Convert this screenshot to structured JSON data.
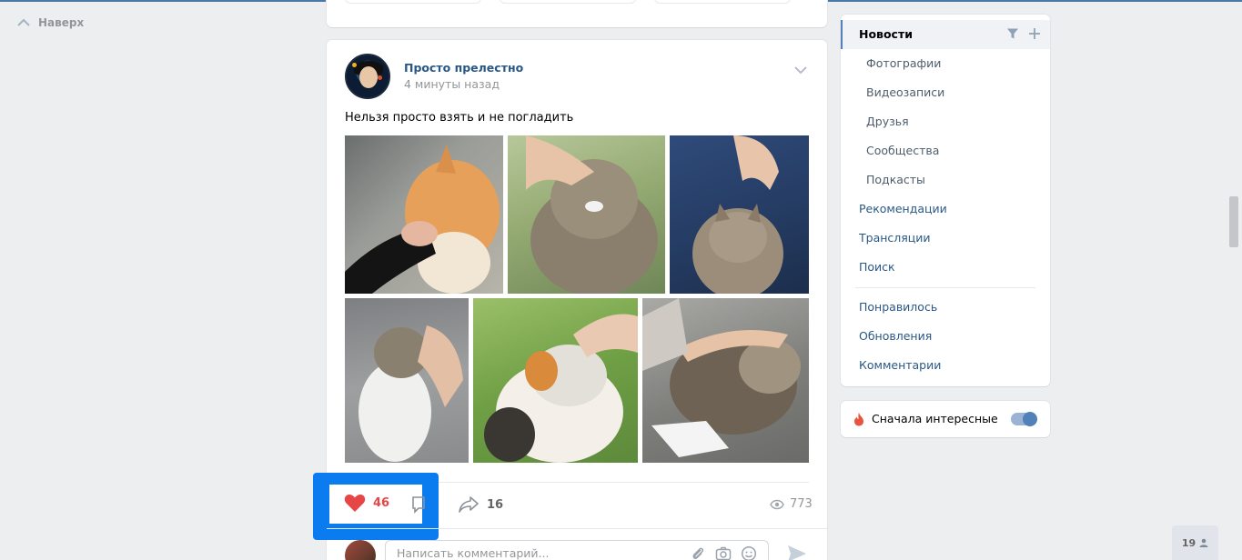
{
  "nav": {
    "back_to_top": "Наверх"
  },
  "post": {
    "author": "Просто прелестно",
    "time": "4 минуты назад",
    "text": "Нельзя просто взять и не погладить",
    "likes": "46",
    "shares": "16",
    "views": "773",
    "comment_placeholder": "Написать комментарий..."
  },
  "menu": {
    "items": [
      {
        "label": "Новости"
      },
      {
        "label": "Фотографии"
      },
      {
        "label": "Видеозаписи"
      },
      {
        "label": "Друзья"
      },
      {
        "label": "Сообщества"
      },
      {
        "label": "Подкасты"
      },
      {
        "label": "Рекомендации"
      },
      {
        "label": "Трансляции"
      },
      {
        "label": "Поиск"
      },
      {
        "label": "Понравилось"
      },
      {
        "label": "Обновления"
      },
      {
        "label": "Комментарии"
      }
    ]
  },
  "interesting_first": {
    "label": "Сначала интересные",
    "enabled": true
  },
  "online_count": "19",
  "colors": {
    "accent": "#5181b8",
    "link": "#2a5885",
    "like": "#e64646",
    "highlight": "#0a7cf0"
  },
  "icons": [
    "chevron-up-icon",
    "chevron-down-icon",
    "heart-icon",
    "comment-icon",
    "share-icon",
    "eye-icon",
    "attach-icon",
    "camera-icon",
    "smile-icon",
    "send-icon",
    "filter-icon",
    "plus-icon",
    "fire-icon",
    "person-icon"
  ]
}
